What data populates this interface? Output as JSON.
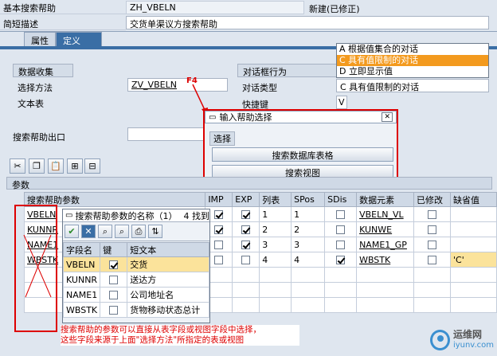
{
  "header": {
    "basic_search_help_label": "基本搜索帮助",
    "basic_search_help_value": "ZH_VBELN",
    "status": "新建(已修正)",
    "short_desc_label": "简短描述",
    "short_desc_value": "交货单渠议方搜索帮助"
  },
  "tabs": [
    {
      "label": "属性"
    },
    {
      "label": "定义"
    }
  ],
  "data_collection": {
    "title": "数据收集",
    "selection_method_label": "选择方法",
    "selection_method_value": "ZV_VBELN",
    "text_table_label": "文本表"
  },
  "dialog": {
    "title": "对话框行为",
    "type_label": "对话类型",
    "type_value": "C 具有值限制的对话",
    "hotkey_label": "快捷键",
    "hotkey_value": "V"
  },
  "dialog_dropdown": {
    "options": [
      {
        "label": "A 根据值集合的对话"
      },
      {
        "label": "C 具有值限制的对话"
      },
      {
        "label": "D 立即显示值"
      }
    ],
    "selected_index": 1
  },
  "exit": {
    "label": "搜索帮助出口"
  },
  "annotation_f4": "F4",
  "input_help_popup": {
    "title": "输入帮助选择",
    "group_label": "选择",
    "btn_db_table": "搜索数据库表格",
    "btn_view": "搜索视图"
  },
  "params_section": {
    "title": "参数",
    "columns": [
      "搜索帮助参数",
      "IMP",
      "EXP",
      "列表",
      "SPos",
      "SDis",
      "数据元素",
      "已修改",
      "缺省值"
    ],
    "rows": [
      {
        "param": "VBELN",
        "imp": true,
        "exp": true,
        "list": "1",
        "spos": "1",
        "sdis": false,
        "element": "VBELN_VL",
        "modified": false,
        "default": ""
      },
      {
        "param": "KUNNR",
        "imp": true,
        "exp": true,
        "list": "2",
        "spos": "2",
        "sdis": false,
        "element": "KUNWE",
        "modified": false,
        "default": ""
      },
      {
        "param": "NAME1",
        "imp": false,
        "exp": true,
        "list": "3",
        "spos": "3",
        "sdis": false,
        "element": "NAME1_GP",
        "modified": false,
        "default": ""
      },
      {
        "param": "WBSTK",
        "imp": false,
        "exp": false,
        "list": "4",
        "spos": "4",
        "sdis": true,
        "element": "WBSTK",
        "modified": false,
        "default": "'C'"
      }
    ]
  },
  "fieldname_popup": {
    "title": "搜索帮助参数的名称（1）",
    "count": "4 找到",
    "columns": [
      "字段名",
      "键",
      "短文本"
    ],
    "rows": [
      {
        "field": "VBELN",
        "key": true,
        "text": "交货"
      },
      {
        "field": "KUNNR",
        "key": false,
        "text": "送达方"
      },
      {
        "field": "NAME1",
        "key": false,
        "text": "公司地址名"
      },
      {
        "field": "WBSTK",
        "key": false,
        "text": "货物移动状态总计"
      }
    ]
  },
  "annotation_note": {
    "line1": "搜索帮助的参数可以直接从表字段或视图字段中选择，",
    "line2": "这些字段来源于上面\"选择方法\"所指定的表或视图"
  },
  "watermark": {
    "brand": "运维网",
    "url": "iyunv.com"
  },
  "colors": {
    "accent": "#3a6ea5",
    "selected_option": "#f39a1e",
    "annotation_red": "#d00000",
    "highlight_row": "#fbe39b"
  }
}
